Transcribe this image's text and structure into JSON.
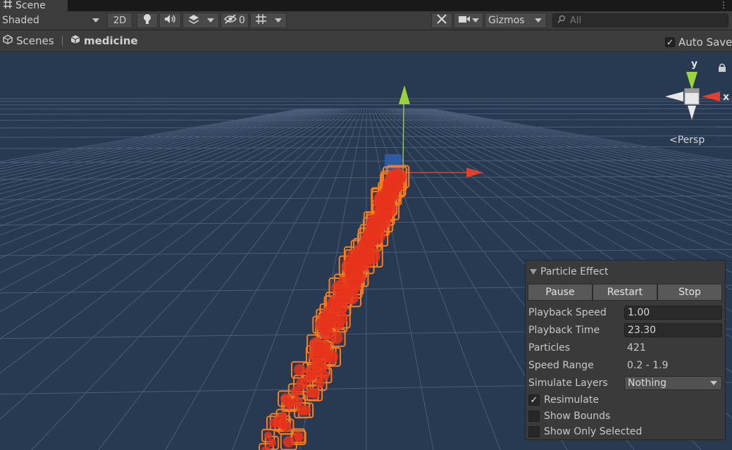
{
  "tab": {
    "title": "Scene",
    "icon": "grid-icon",
    "more_icon": "vertical-ellipsis-icon"
  },
  "toolbar": {
    "shading_mode": "Shaded",
    "mode_2d_label": "2D",
    "hidden_count": "0",
    "gizmos_label": "Gizmos",
    "search_placeholder": "All",
    "icons": [
      "lightbulb-icon",
      "speaker-icon",
      "effects-layers-icon",
      "eye-slash-icon",
      "grid-snap-icon",
      "tools-icon",
      "camera-icon",
      "search-icon"
    ]
  },
  "breadcrumb": {
    "scenes_label": "Scenes",
    "scene_name": "medicine",
    "autosave_label": "Auto Save",
    "autosave_checked": true
  },
  "viewport": {
    "persp_label": "Persp",
    "axis_y": "y",
    "axis_x": "x",
    "background_color": "#283a52"
  },
  "particle_panel": {
    "title": "Particle Effect",
    "buttons": {
      "pause": "Pause",
      "restart": "Restart",
      "stop": "Stop"
    },
    "playback_speed_label": "Playback Speed",
    "playback_speed": "1.00",
    "playback_time_label": "Playback Time",
    "playback_time": "23.30",
    "particles_label": "Particles",
    "particles": "421",
    "speed_range_label": "Speed Range",
    "speed_range": "0.2 - 1.9",
    "simulate_layers_label": "Simulate Layers",
    "simulate_layers": "Nothing",
    "resimulate_label": "Resimulate",
    "resimulate_checked": true,
    "show_bounds_label": "Show Bounds",
    "show_bounds_checked": false,
    "show_only_selected_label": "Show Only Selected",
    "show_only_selected_checked": false
  },
  "colors": {
    "accent_orange": "#ff7a1a",
    "particle_red": "#e8341c",
    "axis_green": "#9ad33a",
    "axis_red": "#e2402a"
  }
}
